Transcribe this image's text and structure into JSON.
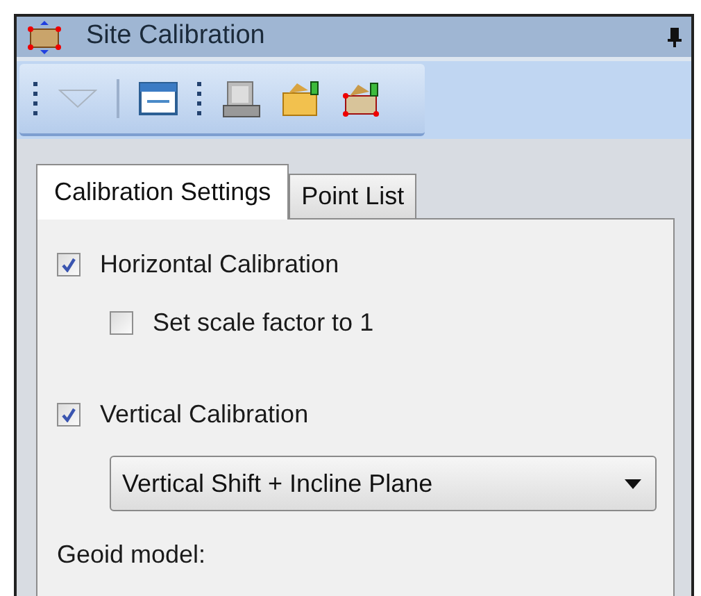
{
  "window": {
    "title": "Site Calibration"
  },
  "tabs": [
    {
      "label": "Calibration Settings",
      "selected": true
    },
    {
      "label": "Point List",
      "selected": false
    }
  ],
  "options": [
    {
      "kind": "checkbox",
      "label": "Horizontal Calibration",
      "checked": true
    },
    {
      "kind": "sub-checkbox",
      "label": "Set scale factor to 1",
      "checked": false
    },
    {
      "kind": "checkbox",
      "label": "Vertical Calibration",
      "checked": true
    },
    {
      "kind": "dropdown",
      "value": "Vertical Shift + Incline Plane"
    },
    {
      "kind": "label",
      "label": "Geoid model:"
    }
  ]
}
